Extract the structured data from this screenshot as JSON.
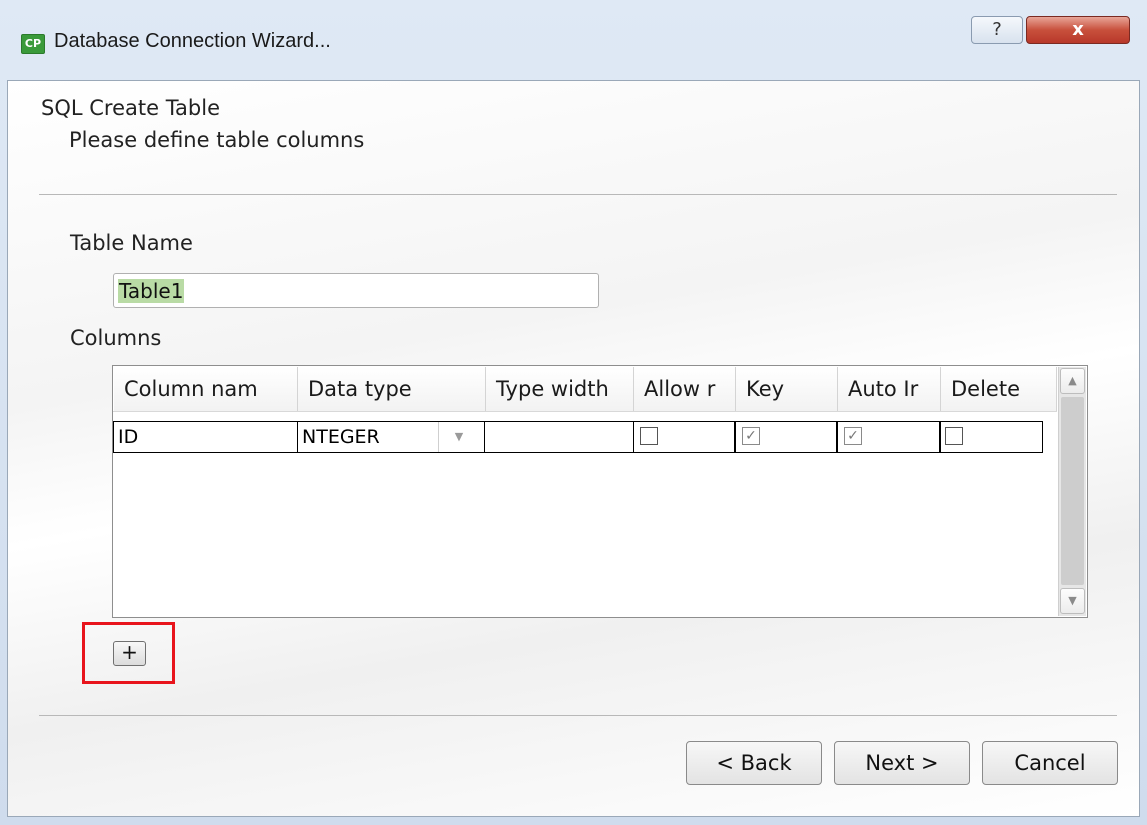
{
  "window": {
    "title": "Database Connection Wizard...",
    "app_icon_text": "CP",
    "help_label": "?",
    "close_label": "x"
  },
  "header": {
    "title": "SQL  Create Table",
    "subtitle": "Please define table columns"
  },
  "form": {
    "table_name_label": "Table Name",
    "table_name_value": "Table1",
    "columns_label": "Columns"
  },
  "grid": {
    "headers": [
      "Column nam",
      "Data type",
      "Type width",
      "Allow r",
      "Key",
      "Auto Ir",
      "Delete"
    ],
    "rows": [
      {
        "column_name": "ID",
        "data_type": "NTEGER",
        "type_width": "",
        "allow_null": false,
        "key": true,
        "auto_inc": true,
        "delete": false
      }
    ],
    "check_mark": "✓",
    "scroll_up": "▲",
    "scroll_down": "▼",
    "dropdown_arrow": "▼"
  },
  "add_button_label": "+",
  "footer": {
    "back_label": "< Back",
    "next_label": "Next >",
    "cancel_label": "Cancel"
  },
  "colors": {
    "highlight": "#e8141c",
    "selection": "#b9dba5",
    "icon_green": "#3a9a3a"
  }
}
